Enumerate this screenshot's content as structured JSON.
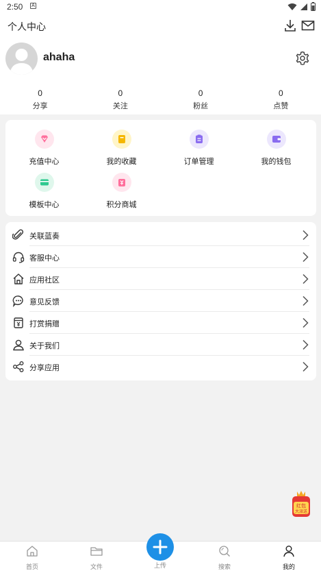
{
  "status": {
    "time": "2:50",
    "notif_glyph": "A"
  },
  "header": {
    "title": "个人中心"
  },
  "profile": {
    "username": "ahaha"
  },
  "stats": [
    {
      "value": "0",
      "label": "分享"
    },
    {
      "value": "0",
      "label": "关注"
    },
    {
      "value": "0",
      "label": "粉丝"
    },
    {
      "value": "0",
      "label": "点赞"
    }
  ],
  "features": [
    {
      "label": "充值中心",
      "icon": "diamond-icon",
      "color": "#ff6f9c",
      "bg": "#ffe6ee"
    },
    {
      "label": "我的收藏",
      "icon": "bookmark-icon",
      "color": "#f5b700",
      "bg": "#fff5c8"
    },
    {
      "label": "订单管理",
      "icon": "order-icon",
      "color": "#8a6cf0",
      "bg": "#ece7fd"
    },
    {
      "label": "我的钱包",
      "icon": "wallet-icon",
      "color": "#8a6cf0",
      "bg": "#ece7fd"
    },
    {
      "label": "模板中心",
      "icon": "card-icon",
      "color": "#2ec98f",
      "bg": "#dff7ec"
    },
    {
      "label": "积分商城",
      "icon": "shop-icon",
      "color": "#ff6f9c",
      "bg": "#ffe6ee"
    }
  ],
  "menu": [
    {
      "label": "关联蓝奏",
      "icon": "paperclip-icon"
    },
    {
      "label": "客服中心",
      "icon": "headset-icon"
    },
    {
      "label": "应用社区",
      "icon": "home-icon"
    },
    {
      "label": "意见反馈",
      "icon": "chat-bubble-icon"
    },
    {
      "label": "打赏捐赠",
      "icon": "donate-box-icon"
    },
    {
      "label": "关于我们",
      "icon": "person-icon"
    },
    {
      "label": "分享应用",
      "icon": "share-icon"
    }
  ],
  "redpacket": {
    "line1": "红包",
    "line2": "大派送"
  },
  "nav": [
    {
      "label": "首页",
      "icon": "home-icon"
    },
    {
      "label": "文件",
      "icon": "folder-icon"
    },
    {
      "label": "上传",
      "icon": "plus-icon"
    },
    {
      "label": "搜索",
      "icon": "search-icon"
    },
    {
      "label": "我的",
      "icon": "person-icon"
    }
  ],
  "colors": {
    "accent": "#1e90e6",
    "background": "#f2f2f2"
  }
}
